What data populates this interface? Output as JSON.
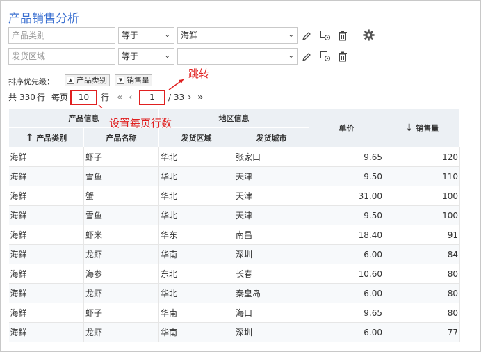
{
  "title": "产品销售分析",
  "filters": [
    {
      "field": "产品类别",
      "operator": "等于",
      "value": "海鲜"
    },
    {
      "field": "发货区域",
      "operator": "等于",
      "value": ""
    }
  ],
  "sort": {
    "label": "排序优先级：",
    "chips": [
      "产品类别",
      "销售量"
    ]
  },
  "pager": {
    "total_prefix": "共",
    "total": "330",
    "total_suffix": "行",
    "per_page_label": "每页",
    "per_page": "10",
    "per_page_suffix": "行",
    "page": "1",
    "page_total": "/ 33"
  },
  "annotations": {
    "jump": "跳转",
    "set_rows": "设置每页行数"
  },
  "table": {
    "group_headers": [
      "产品信息",
      "地区信息"
    ],
    "headers": {
      "category": "产品类别",
      "name": "产品名称",
      "region": "发货区域",
      "city": "发货城市",
      "price": "单价",
      "sales": "销售量"
    },
    "sort_marks": {
      "category": "↑",
      "sales": "↓"
    },
    "rows": [
      [
        "海鲜",
        "虾子",
        "华北",
        "张家口",
        "9.65",
        "120"
      ],
      [
        "海鲜",
        "雪鱼",
        "华北",
        "天津",
        "9.50",
        "110"
      ],
      [
        "海鲜",
        "蟹",
        "华北",
        "天津",
        "31.00",
        "100"
      ],
      [
        "海鲜",
        "雪鱼",
        "华北",
        "天津",
        "9.50",
        "100"
      ],
      [
        "海鲜",
        "虾米",
        "华东",
        "南昌",
        "18.40",
        "91"
      ],
      [
        "海鲜",
        "龙虾",
        "华南",
        "深圳",
        "6.00",
        "84"
      ],
      [
        "海鲜",
        "海参",
        "东北",
        "长春",
        "10.60",
        "80"
      ],
      [
        "海鲜",
        "龙虾",
        "华北",
        "秦皇岛",
        "6.00",
        "80"
      ],
      [
        "海鲜",
        "虾子",
        "华南",
        "海口",
        "9.65",
        "80"
      ],
      [
        "海鲜",
        "龙虾",
        "华南",
        "深圳",
        "6.00",
        "77"
      ]
    ]
  },
  "colors": {
    "accent": "#3a6fd0",
    "annotation": "#e02020",
    "header_bg": "#ecf0f4"
  }
}
